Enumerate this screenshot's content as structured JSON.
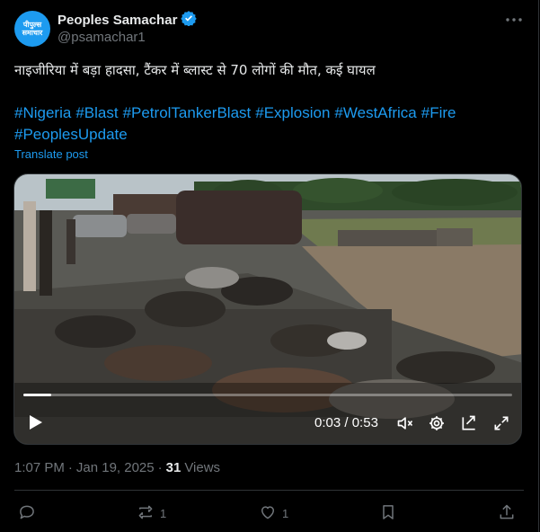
{
  "author": {
    "name": "Peoples Samachar",
    "handle": "@psamachar1",
    "avatar_text_line1": "पीपुल्स",
    "avatar_text_line2": "समाचार",
    "verified_icon": "verified-badge-icon"
  },
  "post": {
    "text": "नाइजीरिया में बड़ा हादसा, टैंकर में ब्लास्ट से 70 लोगों की मौत, कई घायल",
    "hashtags": [
      "#Nigeria",
      "#Blast",
      "#PetrolTankerBlast",
      "#Explosion",
      "#WestAfrica",
      "#Fire",
      "#PeoplesUpdate"
    ],
    "translate_label": "Translate post"
  },
  "video": {
    "current_time": "0:03",
    "separator": " / ",
    "duration": "0:53",
    "progress": 0.057
  },
  "meta": {
    "time": "1:07 PM",
    "dot": "·",
    "date": "Jan 19, 2025",
    "views_count": "31",
    "views_label": "Views"
  },
  "actions": {
    "replies": "",
    "reposts": "1",
    "likes": "1"
  },
  "colors": {
    "accent": "#1d9bf0",
    "background": "#000000",
    "muted": "#71767b"
  }
}
